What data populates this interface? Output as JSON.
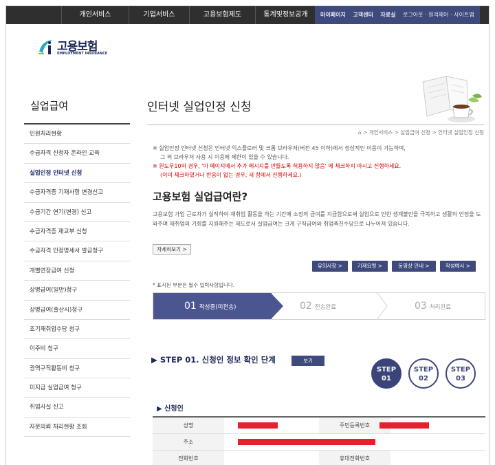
{
  "nav": {
    "main": [
      "개인서비스",
      "기업서비스",
      "고용보험제도",
      "통계및정보공개"
    ],
    "util": [
      "마이페이지",
      "고객센터",
      "자료실",
      "로그아웃 · 원격제어 · 사이트맵"
    ]
  },
  "logo": {
    "name": "고용보험",
    "sub": "EMPLOYMENT INSURANCE"
  },
  "sidebar": {
    "title": "실업급여",
    "items": [
      "민원처리현황",
      "수급자격 신청자 온라인 교육",
      "실업인정 인터넷 신청",
      "수급자격증 기재사항 변경신고",
      "수급기간 연기(변경) 신고",
      "수급자격증 재교부 신청",
      "수급자격 인정명세서 발급청구",
      "개별연장급여 신청",
      "상병급여(일반)청구",
      "상병급여(출산시)청구",
      "조기재취업수당 청구",
      "이주비 청구",
      "광역구직활동비 청구",
      "미지급 실업급여 청구",
      "취업사실 신고",
      "자문의뢰 처리현황 조회"
    ]
  },
  "page": {
    "title": "인터넷 실업인정 신청",
    "breadcrumb": "⌂ > 개인서비스 > 실업급여 신청 > 인터넷 실업인정 신청",
    "notice1": "※ 실업인정 인터넷 신청은 인터넷 익스플로러 및 크롬 브라우저(버전 45 이하)에서 정상적인 이용이 가능하며,",
    "notice2": "그 외 브라우저 사용 시 이용에 제한이 있을 수 있습니다.",
    "notice3": "※ 윈도우10의 경우, '이 페이지에서 추가 메시지를 만들도록 허용하지 않음' 에 체크하지 마시고 진행하세요.",
    "notice4": "(이미 체크하였거나 반응이 없는 경우, 새 창에서 진행하세요.)",
    "section_title": "고용보험 실업급여란?",
    "desc": "고용보험 가입 근로자가 실직하여 재취업 활동을 하는 기간에 소정의 급여를 지급함으로써 실업으로 인한 생계불안을 극복하고 생활의 안정을 도와주며 재취업의 기회를 지원해주는 제도로서 실업급여는 크게 구직급여와 취업촉진수당으로 나누어져 있습니다.",
    "more": "자세히보기 >",
    "buttons": [
      "유의사항 >",
      "기재요령 >",
      "동영상 안내 >",
      "작성예시 >"
    ],
    "required_note": "* 표시된 부분은 필수 입력사항입니다."
  },
  "steps": [
    {
      "num": "01",
      "label": "작성중(미전송)"
    },
    {
      "num": "02",
      "label": "전송완료"
    },
    {
      "num": "03",
      "label": "처리완료"
    }
  ],
  "step1": {
    "heading": "▶ STEP 01. 신청인 정보 확인 단계",
    "view": "보기",
    "circles": [
      {
        "top": "STEP",
        "bottom": "01"
      },
      {
        "top": "STEP",
        "bottom": "02"
      },
      {
        "top": "STEP",
        "bottom": "03"
      }
    ],
    "sub_heading": "▶ 신청인"
  },
  "form": {
    "name": "성명",
    "rrn": "주민등록번호",
    "address": "주소",
    "phone": "전화번호",
    "mobile": "휴대전화번호"
  },
  "colors": {
    "nav_bg": "#2f2f2f",
    "accent": "#3f4a7c",
    "notice_red": "#d40000",
    "redaction": "#e8202b"
  }
}
